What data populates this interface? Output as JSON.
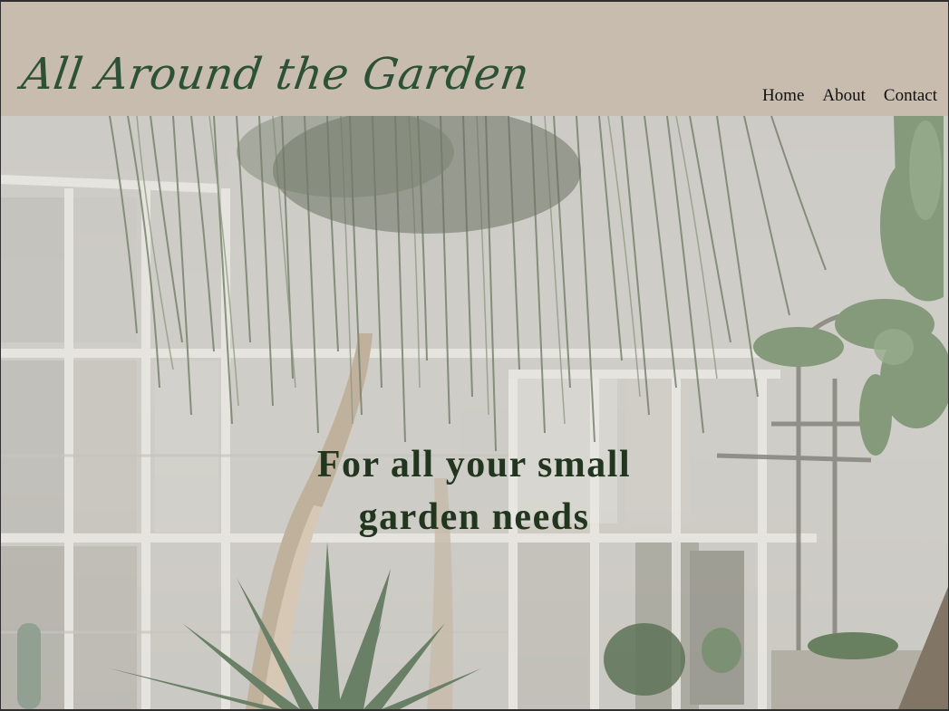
{
  "site": {
    "title": "All Around the Garden"
  },
  "nav": {
    "items": [
      "Home",
      "About",
      "Contact"
    ]
  },
  "hero": {
    "tagline_line1": "For all your small",
    "tagline_line2": "garden needs",
    "image_subject": "greenhouse interior with ponytail palm, cacti and agave"
  },
  "colors": {
    "header_bg": "#c7bcae",
    "logo_green": "#2d5136",
    "tagline_green": "#22361f",
    "nav_text": "#111111"
  }
}
